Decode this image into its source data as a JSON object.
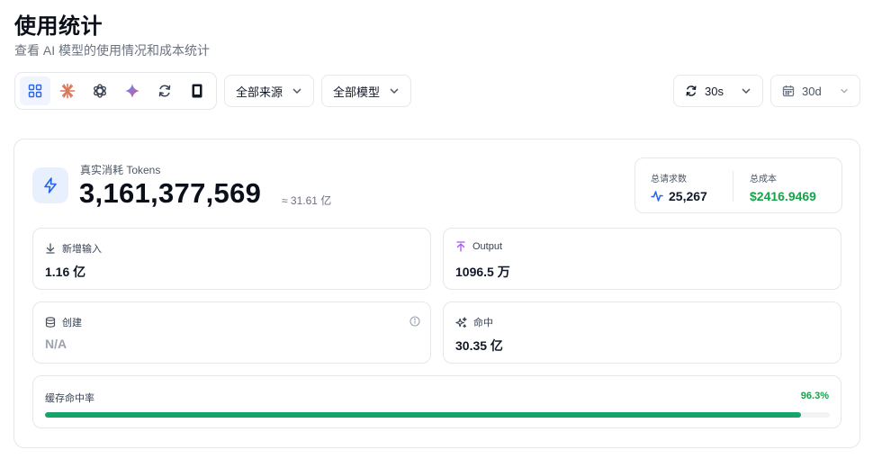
{
  "page": {
    "title": "使用统计",
    "subtitle": "查看 AI 模型的使用情况和成本统计"
  },
  "toolbar": {
    "providers": [
      {
        "name": "all",
        "icon": "grid-icon",
        "active": true
      },
      {
        "name": "anthropic",
        "icon": "anthropic-icon",
        "active": false
      },
      {
        "name": "openai",
        "icon": "openai-icon",
        "active": false
      },
      {
        "name": "gemini",
        "icon": "gemini-icon",
        "active": false
      },
      {
        "name": "cycle",
        "icon": "cycle-icon",
        "active": false
      },
      {
        "name": "device",
        "icon": "device-icon",
        "active": false
      }
    ],
    "source_filter": "全部来源",
    "model_filter": "全部模型",
    "refresh_interval": "30s",
    "time_range": "30d"
  },
  "tokens": {
    "label": "真实消耗 Tokens",
    "value": "3,161,377,569",
    "approx": "≈ 31.61 亿"
  },
  "summary": {
    "requests_label": "总请求数",
    "requests_value": "25,267",
    "cost_label": "总成本",
    "cost_value": "$2416.9469"
  },
  "metrics": {
    "input_label": "新增输入",
    "input_value": "1.16 亿",
    "output_label": "Output",
    "output_value": "1096.5 万",
    "create_label": "创建",
    "create_value": "N/A",
    "hit_label": "命中",
    "hit_value": "30.35 亿"
  },
  "cache": {
    "label": "缓存命中率",
    "percent_text": "96.3%",
    "fraction": 0.963
  },
  "colors": {
    "accent": "#2563eb",
    "success": "#16a34a",
    "progress": "#16a46a",
    "anthropic": "#d97757",
    "output_icon": "#a855f7"
  }
}
